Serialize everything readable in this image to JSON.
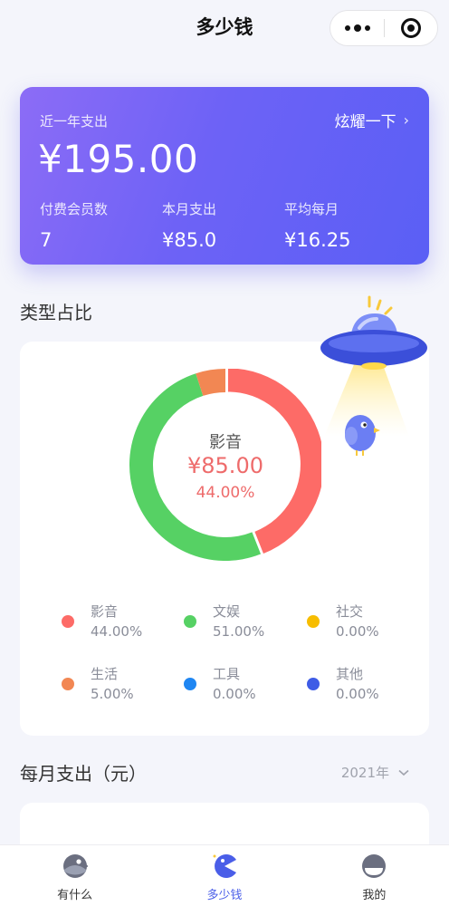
{
  "header": {
    "title": "多少钱"
  },
  "summary": {
    "year_label": "近一年支出",
    "total": "¥195.00",
    "show_off": "炫耀一下",
    "stats": [
      {
        "label": "付费会员数",
        "value": "7"
      },
      {
        "label": "本月支出",
        "value": "¥85.0"
      },
      {
        "label": "平均每月",
        "value": "¥16.25"
      }
    ]
  },
  "type_section": {
    "title": "类型占比"
  },
  "chart_data": {
    "type": "pie",
    "center": {
      "name": "影音",
      "amount": "¥85.00",
      "percent": "44.00%"
    },
    "slices": [
      {
        "name": "影音",
        "percent_label": "44.00%",
        "value": 44,
        "color": "#fd6b67"
      },
      {
        "name": "文娱",
        "percent_label": "51.00%",
        "value": 51,
        "color": "#56d164"
      },
      {
        "name": "社交",
        "percent_label": "0.00%",
        "value": 0,
        "color": "#f7bd00"
      },
      {
        "name": "生活",
        "percent_label": "5.00%",
        "value": 5,
        "color": "#f28753"
      },
      {
        "name": "工具",
        "percent_label": "0.00%",
        "value": 0,
        "color": "#1f86f2"
      },
      {
        "name": "其他",
        "percent_label": "0.00%",
        "value": 0,
        "color": "#3e5ce6"
      }
    ]
  },
  "monthly_section": {
    "title": "每月支出（元）",
    "year": "2021年"
  },
  "tabbar": {
    "tabs": [
      {
        "label": "有什么"
      },
      {
        "label": "多少钱"
      },
      {
        "label": "我的"
      }
    ]
  }
}
